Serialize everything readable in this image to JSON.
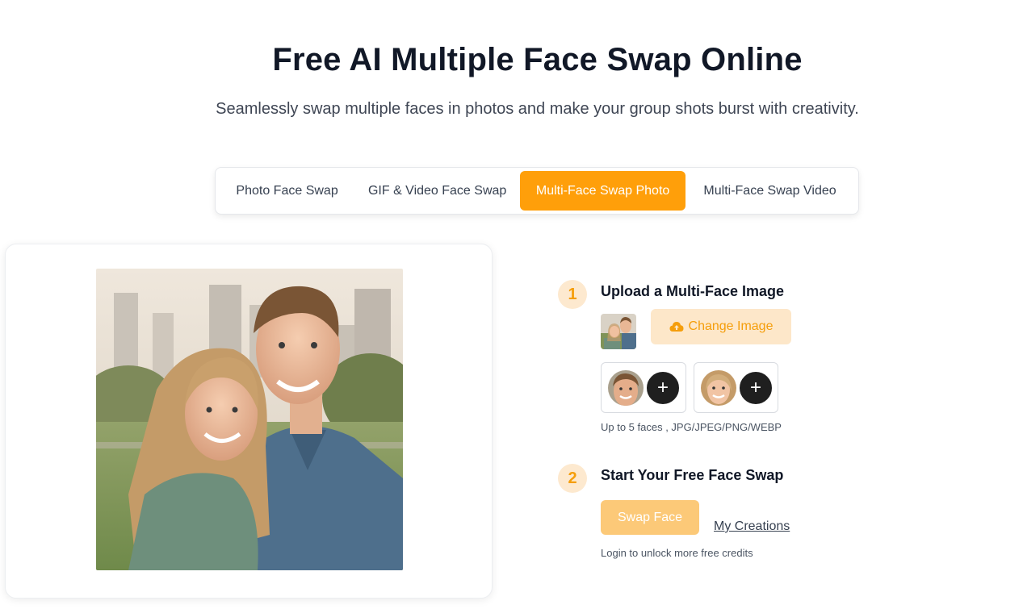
{
  "header": {
    "title": "Free AI Multiple Face Swap Online",
    "subtitle": "Seamlessly swap multiple faces in photos and make your group shots burst with creativity."
  },
  "tabs": [
    {
      "label": "Photo Face Swap",
      "active": false
    },
    {
      "label": "GIF & Video Face Swap",
      "active": false
    },
    {
      "label": "Multi-Face Swap Photo",
      "active": true
    },
    {
      "label": "Multi-Face Swap Video",
      "active": false
    }
  ],
  "steps": {
    "step1": {
      "number": "1",
      "title": "Upload a Multi-Face Image",
      "change_label": "Change Image",
      "change_icon": "cloud-upload-icon",
      "faces": [
        {
          "icon": "plus-icon",
          "plus": "+"
        },
        {
          "icon": "plus-icon",
          "plus": "+"
        }
      ],
      "hint": "Up to 5 faces , JPG/JPEG/PNG/WEBP"
    },
    "step2": {
      "number": "2",
      "title": "Start Your Free Face Swap",
      "swap_label": "Swap Face",
      "creations_label": "My Creations",
      "login_hint": "Login to unlock more free credits"
    }
  },
  "colors": {
    "accent": "#ff9f0a",
    "accent_light": "#fde7c9",
    "swap_button": "#fcc978"
  }
}
